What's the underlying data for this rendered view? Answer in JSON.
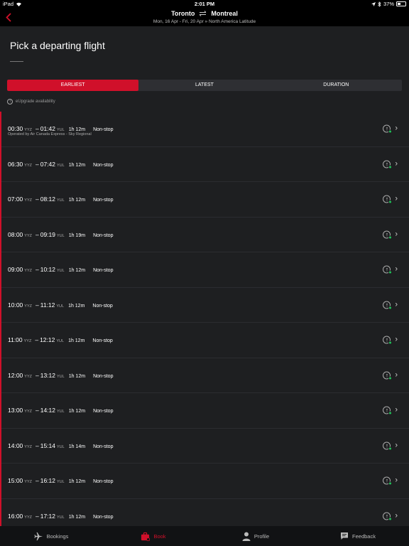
{
  "status_bar": {
    "device": "iPad",
    "time": "2:01 PM",
    "battery": "37%"
  },
  "header": {
    "from": "Toronto",
    "to": "Montreal",
    "subtitle": "Mon, 16 Apr - Fri, 20 Apr  »  North America  Latitude"
  },
  "page": {
    "title": "Pick a departing flight",
    "upgrade_note": "eUpgrade availability"
  },
  "tabs": [
    {
      "label": "EARLIEST",
      "active": true
    },
    {
      "label": "LATEST",
      "active": false
    },
    {
      "label": "DURATION",
      "active": false
    }
  ],
  "flights": [
    {
      "dep": "00:30",
      "dep_apt": "YYZ",
      "arr": "01:42",
      "arr_apt": "YUL",
      "duration": "1h 12m",
      "stops": "Non-stop",
      "operator": "Operated by Air Canada Express - Sky Regional"
    },
    {
      "dep": "06:30",
      "dep_apt": "YYZ",
      "arr": "07:42",
      "arr_apt": "YUL",
      "duration": "1h 12m",
      "stops": "Non-stop"
    },
    {
      "dep": "07:00",
      "dep_apt": "YYZ",
      "arr": "08:12",
      "arr_apt": "YUL",
      "duration": "1h 12m",
      "stops": "Non-stop"
    },
    {
      "dep": "08:00",
      "dep_apt": "YYZ",
      "arr": "09:19",
      "arr_apt": "YUL",
      "duration": "1h 19m",
      "stops": "Non-stop"
    },
    {
      "dep": "09:00",
      "dep_apt": "YYZ",
      "arr": "10:12",
      "arr_apt": "YUL",
      "duration": "1h 12m",
      "stops": "Non-stop"
    },
    {
      "dep": "10:00",
      "dep_apt": "YYZ",
      "arr": "11:12",
      "arr_apt": "YUL",
      "duration": "1h 12m",
      "stops": "Non-stop"
    },
    {
      "dep": "11:00",
      "dep_apt": "YYZ",
      "arr": "12:12",
      "arr_apt": "YUL",
      "duration": "1h 12m",
      "stops": "Non-stop"
    },
    {
      "dep": "12:00",
      "dep_apt": "YYZ",
      "arr": "13:12",
      "arr_apt": "YUL",
      "duration": "1h 12m",
      "stops": "Non-stop"
    },
    {
      "dep": "13:00",
      "dep_apt": "YYZ",
      "arr": "14:12",
      "arr_apt": "YUL",
      "duration": "1h 12m",
      "stops": "Non-stop"
    },
    {
      "dep": "14:00",
      "dep_apt": "YYZ",
      "arr": "15:14",
      "arr_apt": "YUL",
      "duration": "1h 14m",
      "stops": "Non-stop"
    },
    {
      "dep": "15:00",
      "dep_apt": "YYZ",
      "arr": "16:12",
      "arr_apt": "YUL",
      "duration": "1h 12m",
      "stops": "Non-stop"
    },
    {
      "dep": "16:00",
      "dep_apt": "YYZ",
      "arr": "17:12",
      "arr_apt": "YUL",
      "duration": "1h 12m",
      "stops": "Non-stop"
    }
  ],
  "tab_bar": [
    {
      "label": "Bookings",
      "icon": "airplane-icon",
      "active": false
    },
    {
      "label": "Book",
      "icon": "suitcase-icon",
      "active": true
    },
    {
      "label": "Profile",
      "icon": "person-icon",
      "active": false
    },
    {
      "label": "Feedback",
      "icon": "chat-icon",
      "active": false
    }
  ],
  "colors": {
    "accent": "#d0102a",
    "available": "#1fc45a",
    "background": "#1e1f21"
  }
}
